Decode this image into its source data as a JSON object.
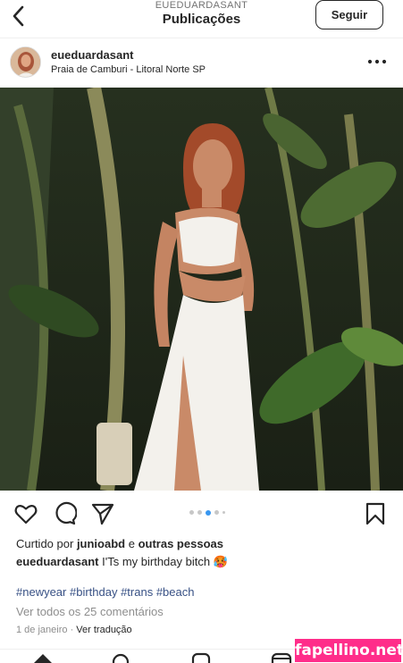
{
  "header": {
    "account_handle": "EUEDUARDASANT",
    "title": "Publicações",
    "follow_label": "Seguir"
  },
  "post": {
    "username": "eueduardasant",
    "location": "Praia de Camburi - Litoral Norte SP",
    "carousel": {
      "count": 5,
      "active_index": 2
    },
    "likes": {
      "prefix": "Curtido por",
      "user": "junioabd",
      "connector": "e",
      "others": "outras pessoas"
    },
    "caption": {
      "username": "eueduardasant",
      "text": "I'Ts my birthday bitch 🥵"
    },
    "hashtags": "#newyear #birthday #trans #beach",
    "comments_link": "Ver todos os 25 comentários",
    "date": "1 de janeiro",
    "separator": "·",
    "translate_link": "Ver tradução"
  },
  "watermark": "fapellino.net",
  "icons": {
    "back": "chevron-left-icon",
    "more": "more-horizontal-icon",
    "like": "heart-icon",
    "comment": "comment-icon",
    "share": "share-icon",
    "save": "bookmark-icon"
  },
  "colors": {
    "hashtag": "#385185",
    "muted": "#8e8e8e",
    "carousel_active": "#3897f0",
    "watermark_bg": "#ff2d8a"
  }
}
